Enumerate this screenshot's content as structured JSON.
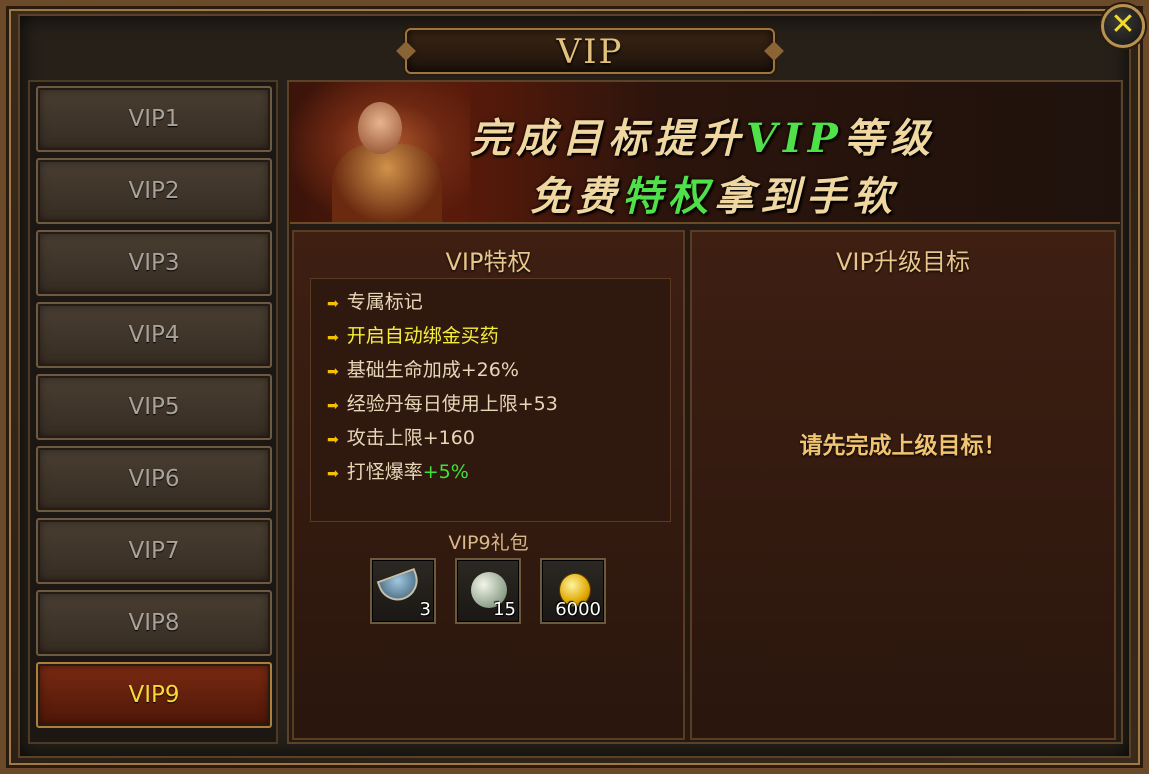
{
  "window": {
    "title": "VIP",
    "close_label": "✕"
  },
  "sidebar": {
    "tabs": [
      {
        "label": "VIP1",
        "active": false
      },
      {
        "label": "VIP2",
        "active": false
      },
      {
        "label": "VIP3",
        "active": false
      },
      {
        "label": "VIP4",
        "active": false
      },
      {
        "label": "VIP5",
        "active": false
      },
      {
        "label": "VIP6",
        "active": false
      },
      {
        "label": "VIP7",
        "active": false
      },
      {
        "label": "VIP8",
        "active": false
      },
      {
        "label": "VIP9",
        "active": true
      }
    ]
  },
  "banner": {
    "line1_a": "完成目标提升",
    "line1_b": "VIP",
    "line1_c": "等级",
    "line2_a": "免费",
    "line2_b": "特权",
    "line2_c": "拿到手软"
  },
  "privileges": {
    "title": "VIP特权",
    "items": [
      {
        "text": "专属标记",
        "suffix": "",
        "highlight": false
      },
      {
        "text": "开启自动绑金买药",
        "suffix": "",
        "highlight": true
      },
      {
        "text": "基础生命加成+26%",
        "suffix": "",
        "highlight": false
      },
      {
        "text": "经验丹每日使用上限+53",
        "suffix": "",
        "highlight": false
      },
      {
        "text": "攻击上限+160",
        "suffix": "",
        "highlight": false
      },
      {
        "text": "打怪爆率",
        "suffix": "+5%",
        "highlight": false
      }
    ],
    "gift_title": "VIP9礼包",
    "gifts": [
      {
        "icon": "potion-bowl-icon",
        "qty": "3"
      },
      {
        "icon": "pearl-orb-icon",
        "qty": "15"
      },
      {
        "icon": "gold-coin-icon",
        "qty": "6000"
      }
    ]
  },
  "target": {
    "title": "VIP升级目标",
    "message": "请先完成上级目标！"
  },
  "colors": {
    "accent_gold": "#e2c17c",
    "active_tab": "#7a2a12",
    "active_tab_text": "#f7d838",
    "highlight_green": "#3ee23a"
  }
}
